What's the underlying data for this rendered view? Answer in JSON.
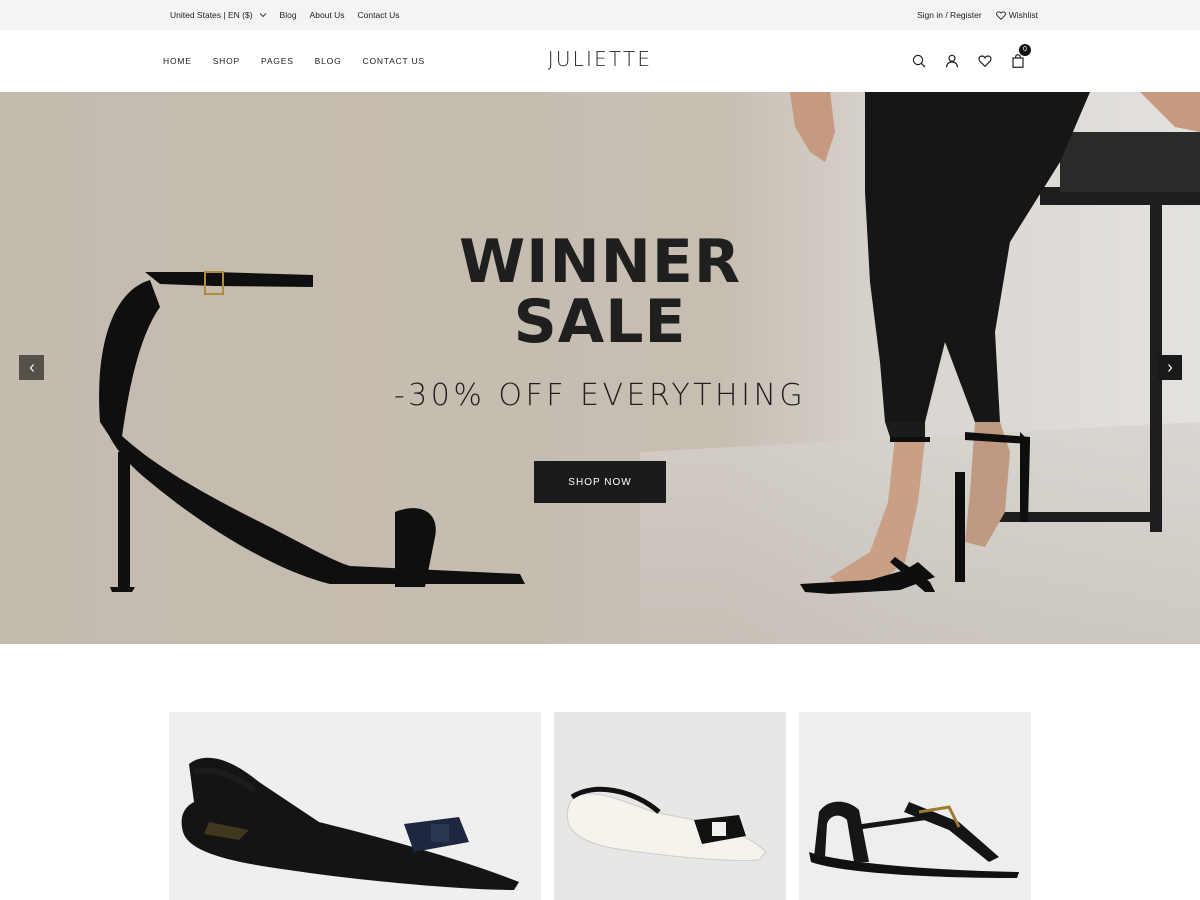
{
  "topbar": {
    "locale": "United States | EN ($)",
    "links": [
      "Blog",
      "About Us",
      "Contact Us"
    ],
    "signin": "Sign in / Register",
    "wishlist": "Wishlist"
  },
  "header": {
    "logo": "JULIETTE",
    "nav": [
      "HOME",
      "SHOP",
      "PAGES",
      "BLOG",
      "CONTACT US"
    ],
    "icons": [
      "search-icon",
      "account-icon",
      "wishlist-heart-icon",
      "cart-bag-icon"
    ],
    "cart_count": "0"
  },
  "hero": {
    "title_line1": "WINNER",
    "title_line2": "SALE",
    "subtitle": "-30% OFF EVERYTHING",
    "cta": "SHOP NOW",
    "prev_icon": "chevron-left-icon",
    "next_icon": "chevron-right-icon",
    "background_color": "#c6bdb1"
  },
  "products": [
    {
      "image": "black-slingback-flat-with-bow"
    },
    {
      "image": "white-black-slingback-flat-with-bow"
    },
    {
      "image": "black-strappy-flat-sandal"
    }
  ],
  "colors": {
    "accent_dark": "#1b1b1b",
    "topbar_bg": "#f4f4f4"
  }
}
